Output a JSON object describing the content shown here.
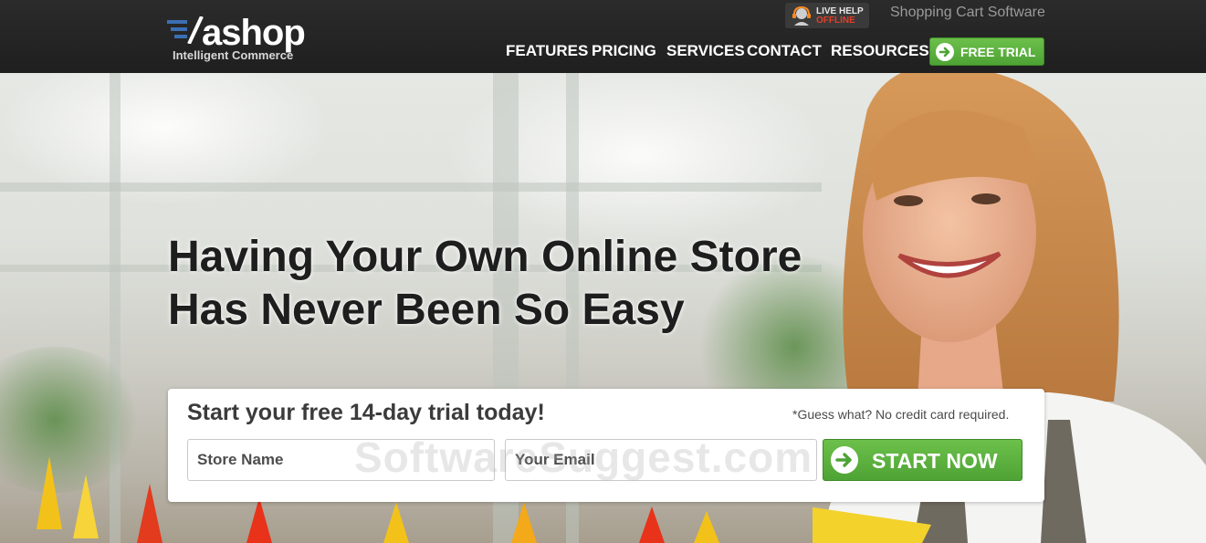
{
  "header": {
    "logo": {
      "wordmark": "ashop",
      "tagline": "Intelligent Commerce"
    },
    "live_help": {
      "title": "LIVE HELP",
      "status": "OFFLINE"
    },
    "tagline": "Shopping Cart Software",
    "nav": [
      {
        "label": "FEATURES"
      },
      {
        "label": "PRICING"
      },
      {
        "label": "SERVICES"
      },
      {
        "label": "CONTACT"
      },
      {
        "label": "RESOURCES"
      }
    ],
    "trial_button": {
      "label": "FREE TRIAL",
      "icon": "arrow-right-circle-icon"
    }
  },
  "hero": {
    "headline_line1": "Having Your Own Online Store",
    "headline_line2": "Has Never Been So Easy"
  },
  "signup": {
    "title": "Start your free 14-day trial today!",
    "note": "*Guess what? No credit card required.",
    "store_name_placeholder": "Store Name",
    "email_placeholder": "Your Email",
    "submit_label": "START NOW"
  },
  "watermark": "SoftwareSuggest.com",
  "colors": {
    "header_bg": "#262626",
    "accent_green": "#5cb23e",
    "offline_red": "#e0402a",
    "logo_blue": "#3b6fb5"
  }
}
